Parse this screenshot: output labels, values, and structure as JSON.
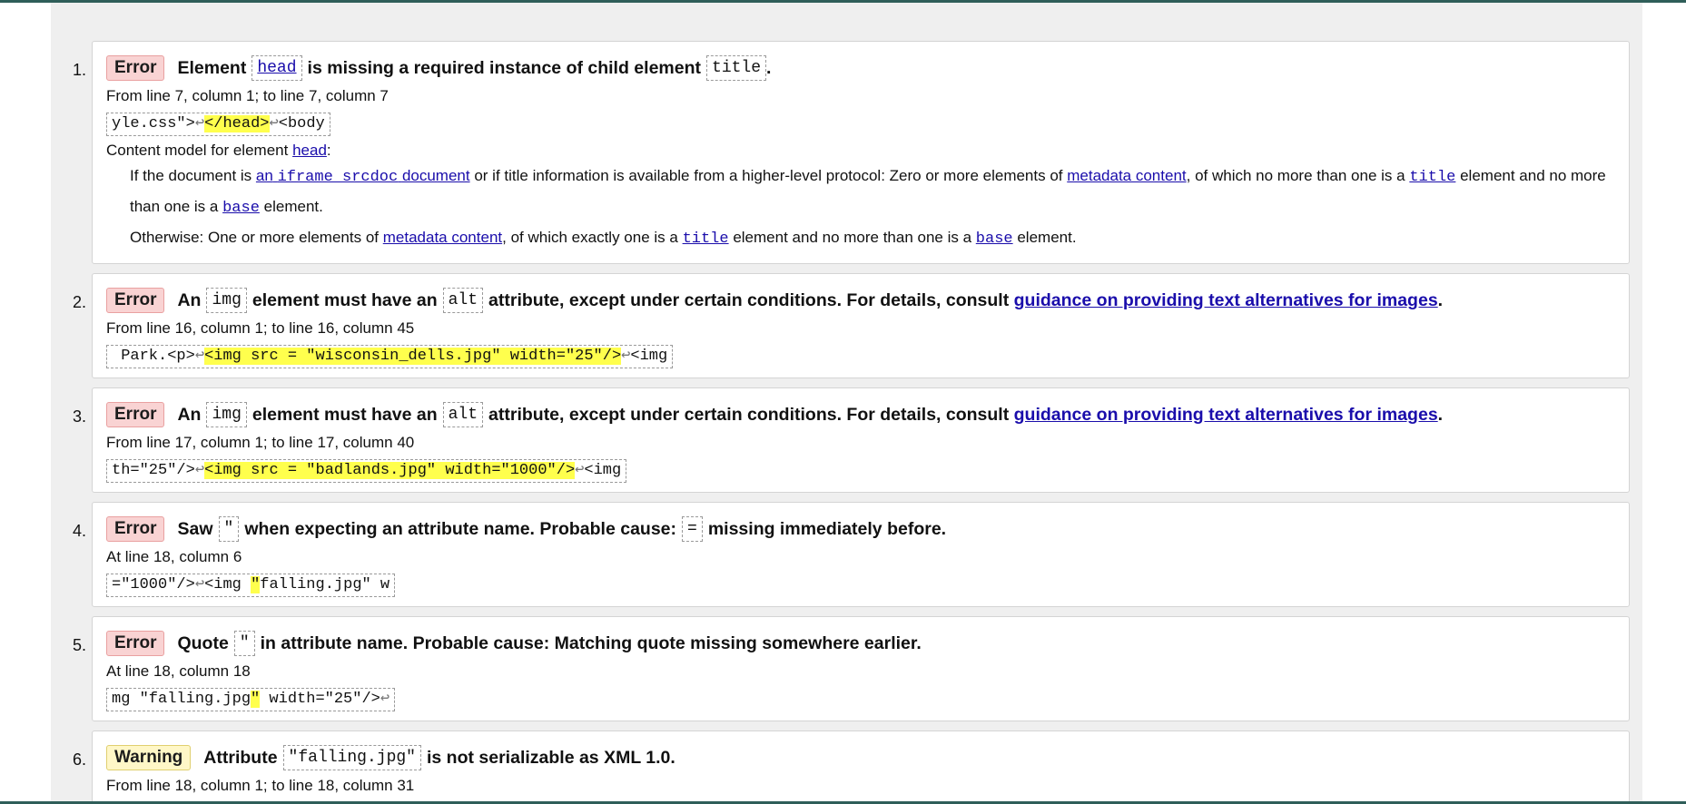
{
  "messages": [
    {
      "num": "1.",
      "type": "Error",
      "parts": [
        "Element",
        "head",
        "is missing a required instance of child element",
        "title",
        "."
      ],
      "location": "From line 7, column 1; to line 7, column 7",
      "extract": {
        "before": "yle.css\">",
        "lf1": "↩",
        "highlight": "</head>",
        "lf2": "↩",
        "after": "<body"
      },
      "details": {
        "intro": "Content model for element",
        "intro_link": "head",
        "intro_colon": ":",
        "line1": {
          "a": "If the document is",
          "link1": "an",
          "code1": "iframe srcdoc",
          "link1b": "document",
          "b": "or if title information is available from a higher-level protocol: Zero or more elements of",
          "link2": "metadata content",
          "c": ", of which no more than one is a",
          "code2": "title",
          "d": "element and no more than one is a",
          "code3": "base",
          "e": "element."
        },
        "line2": {
          "a": "Otherwise: One or more elements of",
          "link1": "metadata content",
          "b": ", of which exactly one is a",
          "code1": "title",
          "c": "element and no more than one is a",
          "code2": "base",
          "d": "element."
        }
      }
    },
    {
      "num": "2.",
      "type": "Error",
      "parts": [
        "An",
        "img",
        "element must have an",
        "alt",
        "attribute, except under certain conditions. For details, consult",
        "guidance on providing text alternatives for images",
        "."
      ],
      "location": "From line 16, column 1; to line 16, column 45",
      "extract": {
        "before": " Park.<p>",
        "lf1": "↩",
        "highlight": "<img src = \"wisconsin_dells.jpg\" width=\"25\"/>",
        "lf2": "↩",
        "after": "<img"
      }
    },
    {
      "num": "3.",
      "type": "Error",
      "parts": [
        "An",
        "img",
        "element must have an",
        "alt",
        "attribute, except under certain conditions. For details, consult",
        "guidance on providing text alternatives for images",
        "."
      ],
      "location": "From line 17, column 1; to line 17, column 40",
      "extract": {
        "before": "th=\"25\"/>",
        "lf1": "↩",
        "highlight": "<img src = \"badlands.jpg\" width=\"1000\"/>",
        "lf2": "↩",
        "after": "<img"
      }
    },
    {
      "num": "4.",
      "type": "Error",
      "parts": [
        "Saw",
        "\"",
        "when expecting an attribute name. Probable cause:",
        "=",
        "missing immediately before."
      ],
      "location": "At line 18, column 6",
      "extract": {
        "before": "=\"1000\"/>",
        "lf1": "↩",
        "mid": "<img ",
        "highlight": "\"",
        "after": "falling.jpg\" w"
      }
    },
    {
      "num": "5.",
      "type": "Error",
      "parts": [
        "Quote",
        "\"",
        "in attribute name. Probable cause: Matching quote missing somewhere earlier."
      ],
      "location": "At line 18, column 18",
      "extract": {
        "before": "mg \"falling.jpg",
        "highlight": "\"",
        "after": " width=\"25\"/>",
        "lf2": "↩"
      }
    },
    {
      "num": "6.",
      "type": "Warning",
      "parts": [
        "Attribute",
        "\"falling.jpg\"",
        "is not serializable as XML 1.0."
      ],
      "location": "From line 18, column 1; to line 18, column 31"
    }
  ]
}
